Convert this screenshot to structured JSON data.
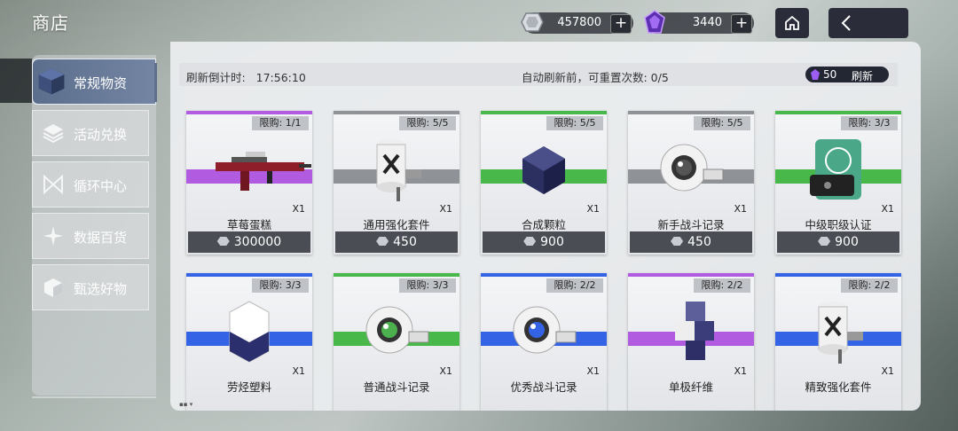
{
  "header": {
    "shop_title": "商店",
    "currency_primary": {
      "icon": "hex-coin-icon",
      "amount": "457800",
      "add_label": "+"
    },
    "currency_premium": {
      "icon": "purple-crystal-icon",
      "amount": "3440",
      "add_label": "+"
    },
    "home_icon": "home-icon",
    "back_icon": "chevron-left-icon"
  },
  "sidebar": {
    "items": [
      {
        "label": "常规物资",
        "icon": "cube-icon",
        "active": true
      },
      {
        "label": "活动兑换",
        "icon": "layers-icon",
        "active": false
      },
      {
        "label": "循环中心",
        "icon": "bowtie-icon",
        "active": false
      },
      {
        "label": "数据百货",
        "icon": "star-burst-icon",
        "active": false
      },
      {
        "label": "甄选好物",
        "icon": "box-icon",
        "active": false
      }
    ]
  },
  "info_bar": {
    "countdown_label": "刷新倒计时:",
    "countdown_value": "17:56:10",
    "reset_text": "自动刷新前，可重置次数: 0/5",
    "refresh_cost": "50",
    "refresh_label": "刷新"
  },
  "colors": {
    "purple": "#b05be0",
    "gray": "#8f9296",
    "green": "#48b84a",
    "blue": "#3563e6"
  },
  "items": [
    {
      "name": "草莓蛋糕",
      "limit": "限购: 1/1",
      "qty": "X1",
      "price": "300000",
      "rarity": "purple",
      "art": "rifle-icon"
    },
    {
      "name": "通用强化套件",
      "limit": "限购: 5/5",
      "qty": "X1",
      "price": "450",
      "rarity": "gray",
      "art": "canister-icon"
    },
    {
      "name": "合成颗粒",
      "limit": "限购: 5/5",
      "qty": "X1",
      "price": "900",
      "rarity": "green",
      "art": "dark-cube-icon"
    },
    {
      "name": "新手战斗记录",
      "limit": "限购: 5/5",
      "qty": "X1",
      "price": "450",
      "rarity": "gray",
      "art": "camera-orb-icon"
    },
    {
      "name": "中级职级认证",
      "limit": "限购: 3/3",
      "qty": "X1",
      "price": "900",
      "rarity": "green",
      "art": "card-device-icon"
    },
    {
      "name": "劳烃塑料",
      "limit": "限购: 3/3",
      "qty": "X1",
      "price": "",
      "rarity": "blue",
      "art": "crystal-block-icon"
    },
    {
      "name": "普通战斗记录",
      "limit": "限购: 3/3",
      "qty": "X1",
      "price": "",
      "rarity": "green",
      "art": "camera-orb-icon"
    },
    {
      "name": "优秀战斗记录",
      "limit": "限购: 2/2",
      "qty": "X1",
      "price": "",
      "rarity": "blue",
      "art": "camera-orb-icon"
    },
    {
      "name": "单极纤维",
      "limit": "限购: 2/2",
      "qty": "X1",
      "price": "",
      "rarity": "purple",
      "art": "stacked-cubes-icon"
    },
    {
      "name": "精致强化套件",
      "limit": "限购: 2/2",
      "qty": "X1",
      "price": "",
      "rarity": "blue",
      "art": "canister-icon"
    }
  ]
}
